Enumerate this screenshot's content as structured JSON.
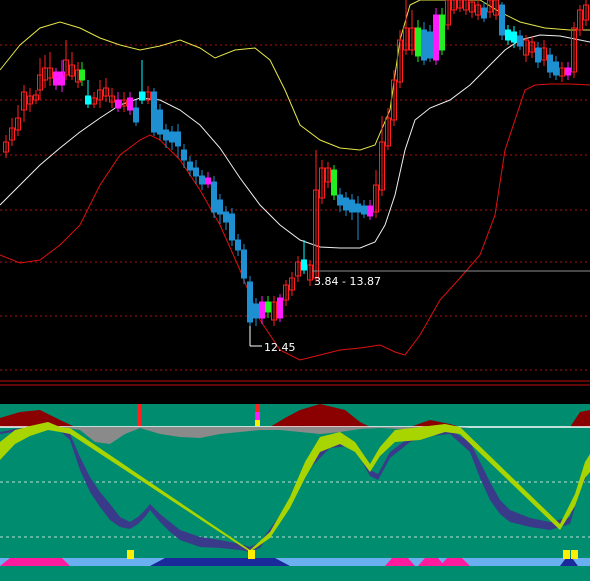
{
  "chart_data": [
    {
      "type": "candlestick",
      "panel": "price",
      "annotations": {
        "low_label": "12.45",
        "range_label": "3.84 - 13.87"
      },
      "bollinger": {
        "upper": "yellow",
        "middle": "white",
        "lower": "red"
      },
      "grid": "dotted-red-horizontal"
    },
    {
      "type": "area",
      "panel": "indicator",
      "background": "#008c6e",
      "series": [
        {
          "color": "#a8d400"
        },
        {
          "color": "#3a3a8a"
        },
        {
          "color": "#8b0000"
        },
        {
          "color": "#8a8a8a"
        }
      ],
      "markers": [
        "yellow-box",
        "magenta-band",
        "blue-band"
      ]
    }
  ],
  "colors": {
    "up": "#ff2020",
    "down": "#1e8fd0",
    "magenta": "#ff1aff",
    "green": "#22ee22",
    "cyan": "#00ffff",
    "grid": "#b01010"
  }
}
